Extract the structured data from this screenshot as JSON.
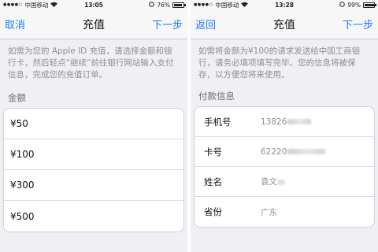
{
  "left": {
    "status": {
      "carrier": "中国移动",
      "time": "13:05",
      "battery": "76%",
      "battery_level": 0.76
    },
    "nav": {
      "cancel": "取消",
      "title": "充值",
      "next": "下一步"
    },
    "intro": "如需为您的 Apple ID 充值，请选择金额和银行卡，然后轻点“继续”前往银行网站输入支付信息，完成您的充值订单。",
    "amount_label": "金额",
    "amounts": [
      "¥50",
      "¥100",
      "¥300",
      "¥500"
    ]
  },
  "right": {
    "status": {
      "carrier": "中国移动",
      "time": "13:28",
      "battery": "99%",
      "battery_level": 0.99
    },
    "nav": {
      "back": "返回",
      "title": "充值",
      "next": "下一步"
    },
    "intro": "如需将金额为¥100的请求发送给中国工商银行，请务必填项填写完毕。您的信息将被保存，以方便您将来使用。",
    "payment_label": "付款信息",
    "fields": [
      {
        "label": "手机号",
        "value": "13826"
      },
      {
        "label": "卡号",
        "value": "62220"
      },
      {
        "label": "姓名",
        "value": "袁文"
      },
      {
        "label": "省份",
        "value": "广东"
      }
    ]
  }
}
